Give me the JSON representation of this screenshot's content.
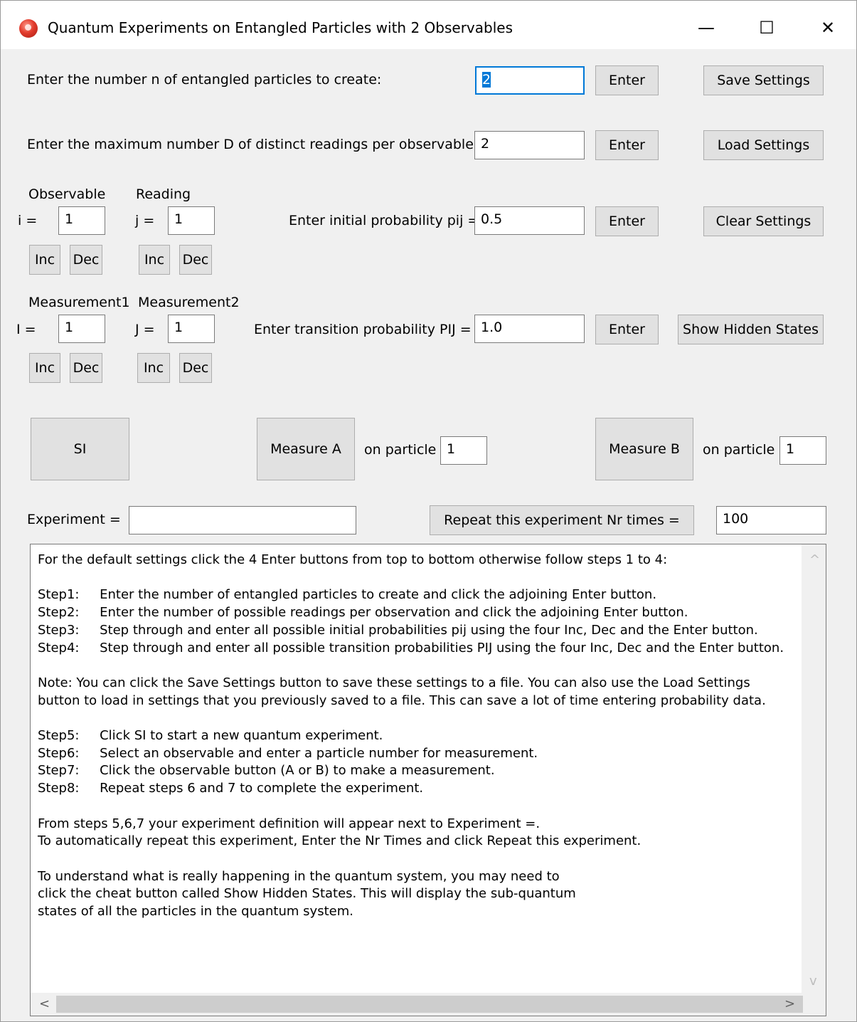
{
  "window": {
    "title": "Quantum Experiments on Entangled Particles with 2 Observables",
    "minimize_glyph": "—",
    "maximize_glyph": "☐",
    "close_glyph": "✕"
  },
  "particles": {
    "label": "Enter the number n of entangled particles to create:",
    "value": "2",
    "enter_label": "Enter"
  },
  "readings": {
    "label": "Enter the maximum number D of distinct readings per observable:",
    "value": "2",
    "enter_label": "Enter"
  },
  "settings": {
    "save_label": "Save Settings",
    "load_label": "Load Settings",
    "clear_label": "Clear Settings",
    "show_hidden_label": "Show Hidden States"
  },
  "initial": {
    "observable_heading": "Observable",
    "reading_heading": "Reading",
    "i_label": "i =",
    "i_value": "1",
    "j_label": "j =",
    "j_value": "1",
    "prob_label": "Enter initial probability pij =",
    "prob_value": "0.5",
    "enter_label": "Enter",
    "inc_label": "Inc",
    "dec_label": "Dec"
  },
  "transition": {
    "m1_heading": "Measurement1",
    "m2_heading": "Measurement2",
    "I_label": "I =",
    "I_value": "1",
    "J_label": "J =",
    "J_value": "1",
    "prob_label": "Enter transition probability PIJ =",
    "prob_value": "1.0",
    "enter_label": "Enter",
    "inc_label": "Inc",
    "dec_label": "Dec"
  },
  "experiment": {
    "si_label": "SI",
    "measure_a_label": "Measure A",
    "measure_b_label": "Measure B",
    "on_particle_label": "on particle",
    "particle_a_value": "1",
    "particle_b_value": "1",
    "experiment_label": "Experiment =",
    "experiment_value": "",
    "repeat_label": "Repeat this experiment Nr times =",
    "repeat_value": "100"
  },
  "instructions": {
    "text": "For the default settings click the 4 Enter buttons from top to bottom otherwise follow steps 1 to 4:\n\nStep1:     Enter the number of entangled particles to create and click the adjoining Enter button.\nStep2:     Enter the number of possible readings per observation and click the adjoining Enter button.\nStep3:     Step through and enter all possible initial probabilities pij using the four Inc, Dec and the Enter button.\nStep4:     Step through and enter all possible transition probabilities PIJ using the four Inc, Dec and the Enter button.\n\nNote: You can click the Save Settings button to save these settings to a file. You can also use the Load Settings\nbutton to load in settings that you previously saved to a file. This can save a lot of time entering probability data.\n\nStep5:     Click SI to start a new quantum experiment.\nStep6:     Select an observable and enter a particle number for measurement.\nStep7:     Click the observable button (A or B) to make a measurement.\nStep8:     Repeat steps 6 and 7 to complete the experiment.\n\nFrom steps 5,6,7 your experiment definition will appear next to Experiment =.\nTo automatically repeat this experiment, Enter the Nr Times and click Repeat this experiment.\n\nTo understand what is really happening in the quantum system, you may need to\nclick the cheat button called Show Hidden States. This will display the sub-quantum\nstates of all the particles in the quantum system."
  },
  "scroll": {
    "up_glyph": "^",
    "down_glyph": "v",
    "left_glyph": "<",
    "right_glyph": ">"
  }
}
